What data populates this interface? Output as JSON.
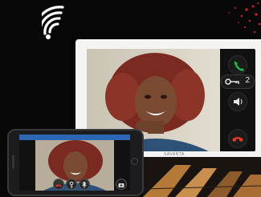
{
  "monitor": {
    "brand": "SAVANTA",
    "door_key_number": "2",
    "controls": [
      "accept-call",
      "door-release",
      "volume",
      "end-call"
    ]
  },
  "phone": {
    "buttons": [
      "end-call",
      "door-release",
      "mute",
      "camera"
    ]
  },
  "colors": {
    "accept": "#2bb24c",
    "end": "#e0382b",
    "app_bar": "#2d66b3",
    "glow": "#d8262b"
  }
}
